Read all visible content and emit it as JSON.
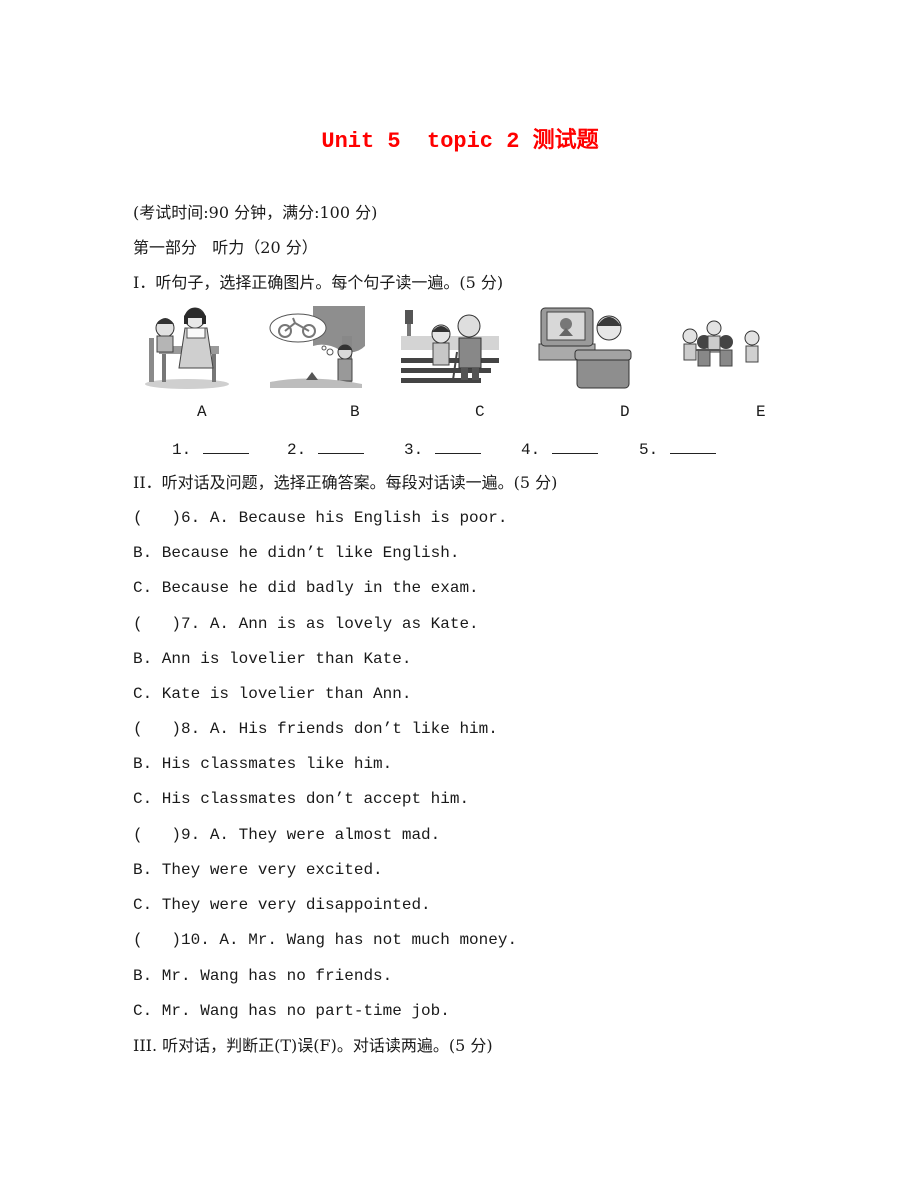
{
  "title": "Unit 5  topic 2 测试题",
  "exam_info": "(考试时间:90 分钟，满分:100 分)",
  "part1_heading": "第一部分   听力（20 分）",
  "section1": {
    "heading": "I．听句子，选择正确图片。每个句子读一遍。(5 分)",
    "pictures": [
      {
        "letter": "A",
        "icon": "mother-helping-girl-at-desk-picture"
      },
      {
        "letter": "B",
        "icon": "boy-dreaming-of-bicycle-picture"
      },
      {
        "letter": "C",
        "icon": "boy-helping-old-man-cross-street-picture"
      },
      {
        "letter": "D",
        "icon": "boy-watching-tv-picture"
      },
      {
        "letter": "E",
        "icon": "children-playing-circle-picture"
      }
    ],
    "blanks": [
      "1.",
      "2.",
      "3.",
      "4.",
      "5."
    ]
  },
  "section2": {
    "heading": "II．听对话及问题，选择正确答案。每段对话读一遍。(5 分)",
    "questions": [
      {
        "stem": "(   )6. A. Because his English is poor.",
        "options": [
          "B. Because he didn’t like English.",
          "C. Because he did badly in the exam."
        ]
      },
      {
        "stem": "(   )7. A. Ann is as lovely as Kate.",
        "options": [
          "B. Ann is lovelier than Kate.",
          "C. Kate is lovelier than Ann."
        ]
      },
      {
        "stem": "(   )8. A. His friends don’t like him.",
        "options": [
          "B. His classmates like him.",
          "C. His classmates don’t accept him."
        ]
      },
      {
        "stem": "(   )9. A. They were almost mad.",
        "options": [
          "B. They were very excited.",
          "C. They were very disappointed."
        ]
      },
      {
        "stem": "(   )10. A. Mr. Wang has not much money.",
        "options": [
          "B. Mr. Wang has no friends.",
          "C. Mr. Wang has no part-time job."
        ]
      }
    ]
  },
  "section3": {
    "heading": "III. 听对话，判断正(T)误(F)。对话读两遍。(5 分)"
  }
}
